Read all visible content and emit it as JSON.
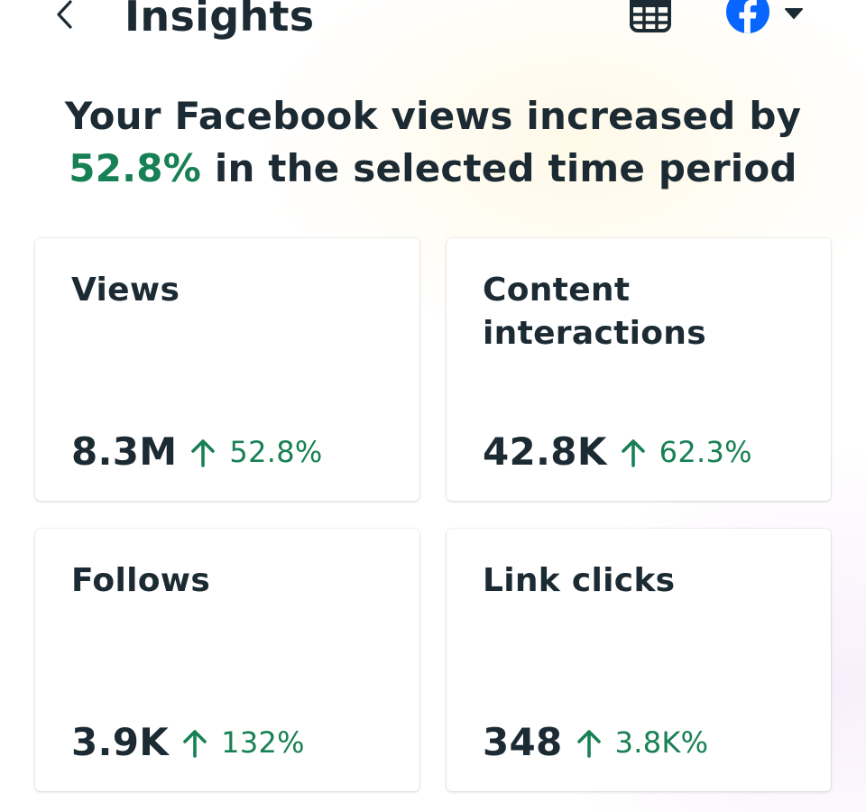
{
  "header": {
    "title": "Insights",
    "back_icon": "chevron-left-icon",
    "calendar_icon": "calendar-icon",
    "account_icon": "facebook-logo-icon",
    "dropdown_icon": "caret-down-icon"
  },
  "summary": {
    "prefix": "Your Facebook views increased by",
    "percent": "52.8%",
    "suffix": "in the selected time period"
  },
  "cards": [
    {
      "title": "Views",
      "value": "8.3M",
      "change": "52.8%",
      "trend": "up"
    },
    {
      "title": "Content interactions",
      "value": "42.8K",
      "change": "62.3%",
      "trend": "up"
    },
    {
      "title": "Follows",
      "value": "3.9K",
      "change": "132%",
      "trend": "up"
    },
    {
      "title": "Link clicks",
      "value": "348",
      "change": "3.8K%",
      "trend": "up"
    }
  ],
  "colors": {
    "text": "#1c2b33",
    "positive": "#188055",
    "facebook_blue": "#0866ff",
    "card_background": "#ffffff"
  }
}
